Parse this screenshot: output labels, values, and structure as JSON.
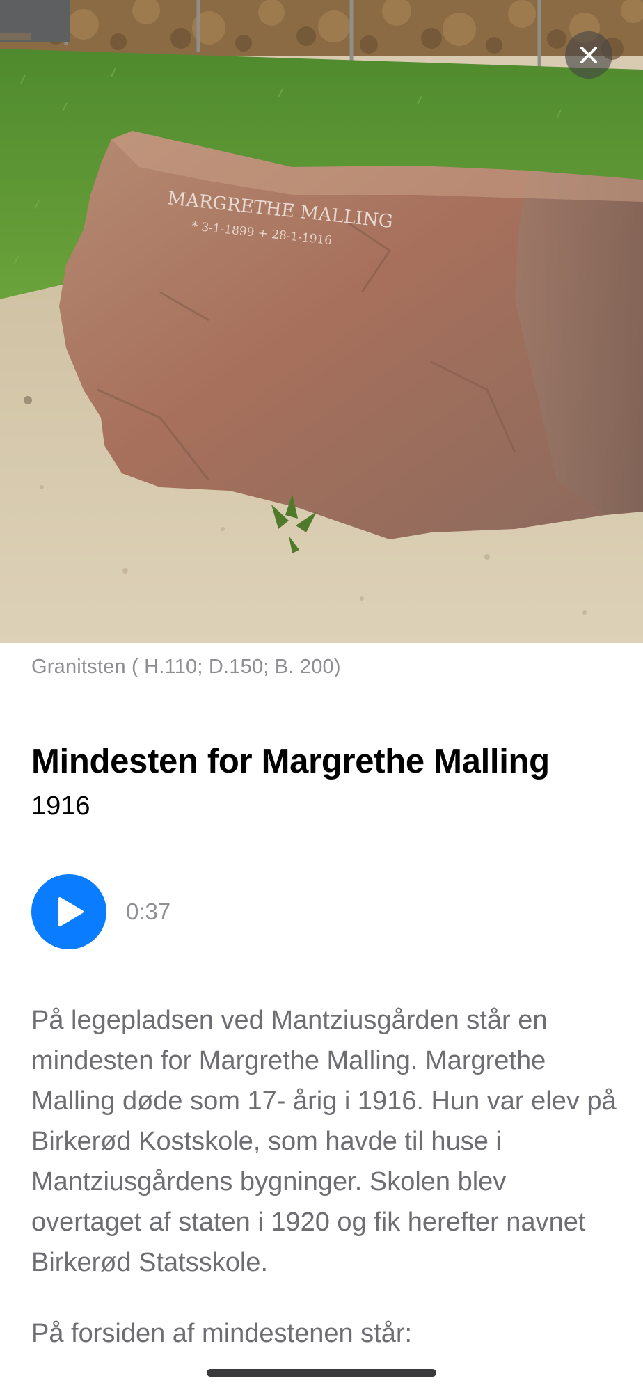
{
  "photo": {
    "alt": "Granitsten med indskrift",
    "inscription_line1": "MARGRETHE MALLING",
    "inscription_line2": "* 3-1-1899 + 28-1-1916"
  },
  "close_button": {
    "icon": "close-icon"
  },
  "caption": "Granitsten ( H.110; D.150; B. 200)",
  "title": "Mindesten for Margrethe Malling",
  "year": "1916",
  "audio": {
    "icon": "play-icon",
    "duration": "0:37",
    "accent_color": "#0a7cff"
  },
  "body": {
    "paragraph1": "På legepladsen ved Mantziusgården står en mindesten for Margrethe Malling. Margrethe Malling døde som 17- årig i 1916. Hun var elev på Birkerød Kostskole, som havde til huse i Mantziusgårdens bygninger. Skolen blev overtaget af staten i 1920 og fik herefter navnet Birkerød Statsskole.",
    "paragraph2": "På forsiden af mindestenen står:"
  }
}
